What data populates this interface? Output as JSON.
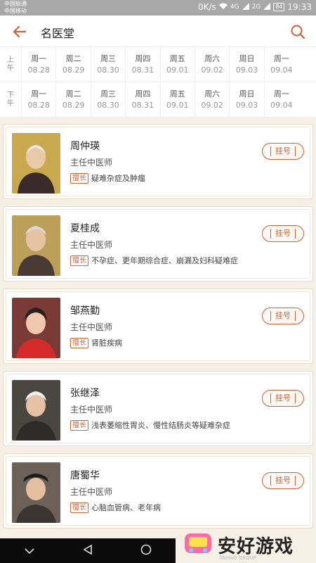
{
  "status": {
    "carrier1": "中国联通",
    "carrier2": "中国移动",
    "speed": "0K/s",
    "net1": "4G",
    "net2": "2G",
    "battery": "84",
    "time": "19:33"
  },
  "nav": {
    "title": "名医堂"
  },
  "schedule": {
    "am": "上\n午",
    "pm": "下\n午",
    "am_days": [
      {
        "week": "周一",
        "date": "08.28"
      },
      {
        "week": "周二",
        "date": "08.29"
      },
      {
        "week": "周三",
        "date": "08.30"
      },
      {
        "week": "周四",
        "date": "08.31"
      },
      {
        "week": "周五",
        "date": "09.01"
      },
      {
        "week": "周六",
        "date": "09.02"
      },
      {
        "week": "周日",
        "date": "09.03"
      },
      {
        "week": "周一",
        "date": "09.04"
      }
    ],
    "pm_days": [
      {
        "week": "周一",
        "date": "08.28"
      },
      {
        "week": "周二",
        "date": "08.29"
      },
      {
        "week": "周三",
        "date": "08.30"
      },
      {
        "week": "周四",
        "date": "08.31"
      },
      {
        "week": "周五",
        "date": "09.01"
      },
      {
        "week": "周六",
        "date": "09.02"
      },
      {
        "week": "周日",
        "date": "09.03"
      },
      {
        "week": "周一",
        "date": "09.04"
      }
    ]
  },
  "doctors": [
    {
      "name": "周仲瑛",
      "title": "主任中医师",
      "tag": "擅长",
      "specialty": "疑难杂症及肿瘤",
      "book": "挂号",
      "photo_bg": "#c9a94e"
    },
    {
      "name": "夏桂成",
      "title": "主任中医师",
      "tag": "擅长",
      "specialty": "不孕症、更年期综合症、崩漏及妇科疑难症",
      "book": "挂号",
      "photo_bg": "#bca05a"
    },
    {
      "name": "邹燕勤",
      "title": "主任中医师",
      "tag": "擅长",
      "specialty": "肾脏疾病",
      "book": "挂号",
      "photo_bg": "#7a3a36"
    },
    {
      "name": "张继泽",
      "title": "主任中医师",
      "tag": "擅长",
      "specialty": "浅表萎缩性胃炎、慢性结肠炎等疑难杂症",
      "book": "挂号",
      "photo_bg": "#4a4640"
    },
    {
      "name": "唐蜀华",
      "title": "主任中医师",
      "tag": "擅长",
      "specialty": "心脑血管病、老年病",
      "book": "挂号",
      "photo_bg": "#6b6156"
    }
  ],
  "watermark": {
    "text": "安好游戏",
    "sub": "ANHAO GROUP"
  },
  "colors": {
    "accent": "#c8643c",
    "background": "#f6efe6"
  }
}
